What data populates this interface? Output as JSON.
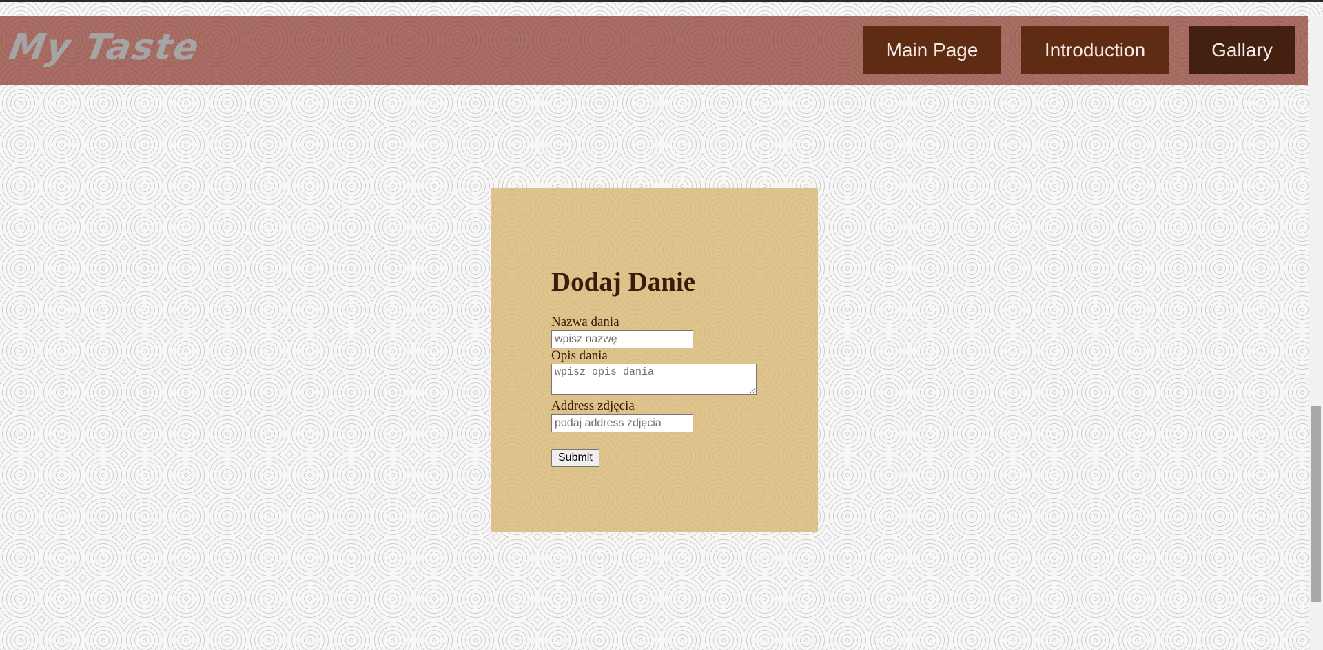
{
  "header": {
    "logo_text": "My Taste",
    "nav": [
      {
        "label": "Main Page"
      },
      {
        "label": "Introduction"
      },
      {
        "label": "Gallary"
      }
    ]
  },
  "form": {
    "title": "Dodaj Danie",
    "name_label": "Nazwa dania",
    "name_placeholder": "wpisz nazwę",
    "desc_label": "Opis dania",
    "desc_placeholder": "wpisz opis dania",
    "photo_label": "Address zdjęcia",
    "photo_placeholder": "podaj address zdjęcia",
    "submit_label": "Submit"
  },
  "colors": {
    "header_bg": "#a4665d",
    "nav_bg": "#5f2b13",
    "nav_active_bg": "#43200f",
    "card_bg": "#ddc188",
    "title_color": "#3d1a0a"
  }
}
